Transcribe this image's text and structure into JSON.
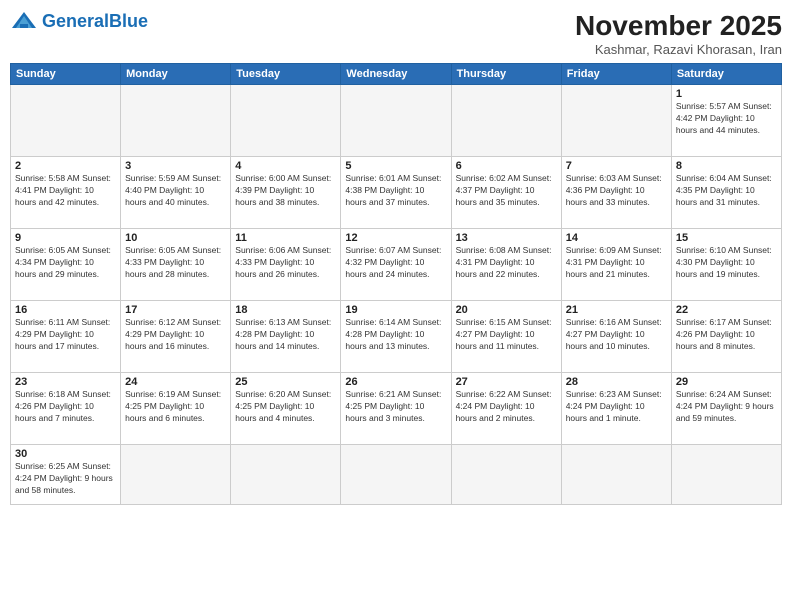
{
  "header": {
    "logo_general": "General",
    "logo_blue": "Blue",
    "month_title": "November 2025",
    "subtitle": "Kashmar, Razavi Khorasan, Iran"
  },
  "weekdays": [
    "Sunday",
    "Monday",
    "Tuesday",
    "Wednesday",
    "Thursday",
    "Friday",
    "Saturday"
  ],
  "weeks": [
    [
      {
        "day": "",
        "info": ""
      },
      {
        "day": "",
        "info": ""
      },
      {
        "day": "",
        "info": ""
      },
      {
        "day": "",
        "info": ""
      },
      {
        "day": "",
        "info": ""
      },
      {
        "day": "",
        "info": ""
      },
      {
        "day": "1",
        "info": "Sunrise: 5:57 AM\nSunset: 4:42 PM\nDaylight: 10 hours and 44 minutes."
      }
    ],
    [
      {
        "day": "2",
        "info": "Sunrise: 5:58 AM\nSunset: 4:41 PM\nDaylight: 10 hours and 42 minutes."
      },
      {
        "day": "3",
        "info": "Sunrise: 5:59 AM\nSunset: 4:40 PM\nDaylight: 10 hours and 40 minutes."
      },
      {
        "day": "4",
        "info": "Sunrise: 6:00 AM\nSunset: 4:39 PM\nDaylight: 10 hours and 38 minutes."
      },
      {
        "day": "5",
        "info": "Sunrise: 6:01 AM\nSunset: 4:38 PM\nDaylight: 10 hours and 37 minutes."
      },
      {
        "day": "6",
        "info": "Sunrise: 6:02 AM\nSunset: 4:37 PM\nDaylight: 10 hours and 35 minutes."
      },
      {
        "day": "7",
        "info": "Sunrise: 6:03 AM\nSunset: 4:36 PM\nDaylight: 10 hours and 33 minutes."
      },
      {
        "day": "8",
        "info": "Sunrise: 6:04 AM\nSunset: 4:35 PM\nDaylight: 10 hours and 31 minutes."
      }
    ],
    [
      {
        "day": "9",
        "info": "Sunrise: 6:05 AM\nSunset: 4:34 PM\nDaylight: 10 hours and 29 minutes."
      },
      {
        "day": "10",
        "info": "Sunrise: 6:05 AM\nSunset: 4:33 PM\nDaylight: 10 hours and 28 minutes."
      },
      {
        "day": "11",
        "info": "Sunrise: 6:06 AM\nSunset: 4:33 PM\nDaylight: 10 hours and 26 minutes."
      },
      {
        "day": "12",
        "info": "Sunrise: 6:07 AM\nSunset: 4:32 PM\nDaylight: 10 hours and 24 minutes."
      },
      {
        "day": "13",
        "info": "Sunrise: 6:08 AM\nSunset: 4:31 PM\nDaylight: 10 hours and 22 minutes."
      },
      {
        "day": "14",
        "info": "Sunrise: 6:09 AM\nSunset: 4:31 PM\nDaylight: 10 hours and 21 minutes."
      },
      {
        "day": "15",
        "info": "Sunrise: 6:10 AM\nSunset: 4:30 PM\nDaylight: 10 hours and 19 minutes."
      }
    ],
    [
      {
        "day": "16",
        "info": "Sunrise: 6:11 AM\nSunset: 4:29 PM\nDaylight: 10 hours and 17 minutes."
      },
      {
        "day": "17",
        "info": "Sunrise: 6:12 AM\nSunset: 4:29 PM\nDaylight: 10 hours and 16 minutes."
      },
      {
        "day": "18",
        "info": "Sunrise: 6:13 AM\nSunset: 4:28 PM\nDaylight: 10 hours and 14 minutes."
      },
      {
        "day": "19",
        "info": "Sunrise: 6:14 AM\nSunset: 4:28 PM\nDaylight: 10 hours and 13 minutes."
      },
      {
        "day": "20",
        "info": "Sunrise: 6:15 AM\nSunset: 4:27 PM\nDaylight: 10 hours and 11 minutes."
      },
      {
        "day": "21",
        "info": "Sunrise: 6:16 AM\nSunset: 4:27 PM\nDaylight: 10 hours and 10 minutes."
      },
      {
        "day": "22",
        "info": "Sunrise: 6:17 AM\nSunset: 4:26 PM\nDaylight: 10 hours and 8 minutes."
      }
    ],
    [
      {
        "day": "23",
        "info": "Sunrise: 6:18 AM\nSunset: 4:26 PM\nDaylight: 10 hours and 7 minutes."
      },
      {
        "day": "24",
        "info": "Sunrise: 6:19 AM\nSunset: 4:25 PM\nDaylight: 10 hours and 6 minutes."
      },
      {
        "day": "25",
        "info": "Sunrise: 6:20 AM\nSunset: 4:25 PM\nDaylight: 10 hours and 4 minutes."
      },
      {
        "day": "26",
        "info": "Sunrise: 6:21 AM\nSunset: 4:25 PM\nDaylight: 10 hours and 3 minutes."
      },
      {
        "day": "27",
        "info": "Sunrise: 6:22 AM\nSunset: 4:24 PM\nDaylight: 10 hours and 2 minutes."
      },
      {
        "day": "28",
        "info": "Sunrise: 6:23 AM\nSunset: 4:24 PM\nDaylight: 10 hours and 1 minute."
      },
      {
        "day": "29",
        "info": "Sunrise: 6:24 AM\nSunset: 4:24 PM\nDaylight: 9 hours and 59 minutes."
      }
    ],
    [
      {
        "day": "30",
        "info": "Sunrise: 6:25 AM\nSunset: 4:24 PM\nDaylight: 9 hours and 58 minutes."
      },
      {
        "day": "",
        "info": ""
      },
      {
        "day": "",
        "info": ""
      },
      {
        "day": "",
        "info": ""
      },
      {
        "day": "",
        "info": ""
      },
      {
        "day": "",
        "info": ""
      },
      {
        "day": "",
        "info": ""
      }
    ]
  ]
}
